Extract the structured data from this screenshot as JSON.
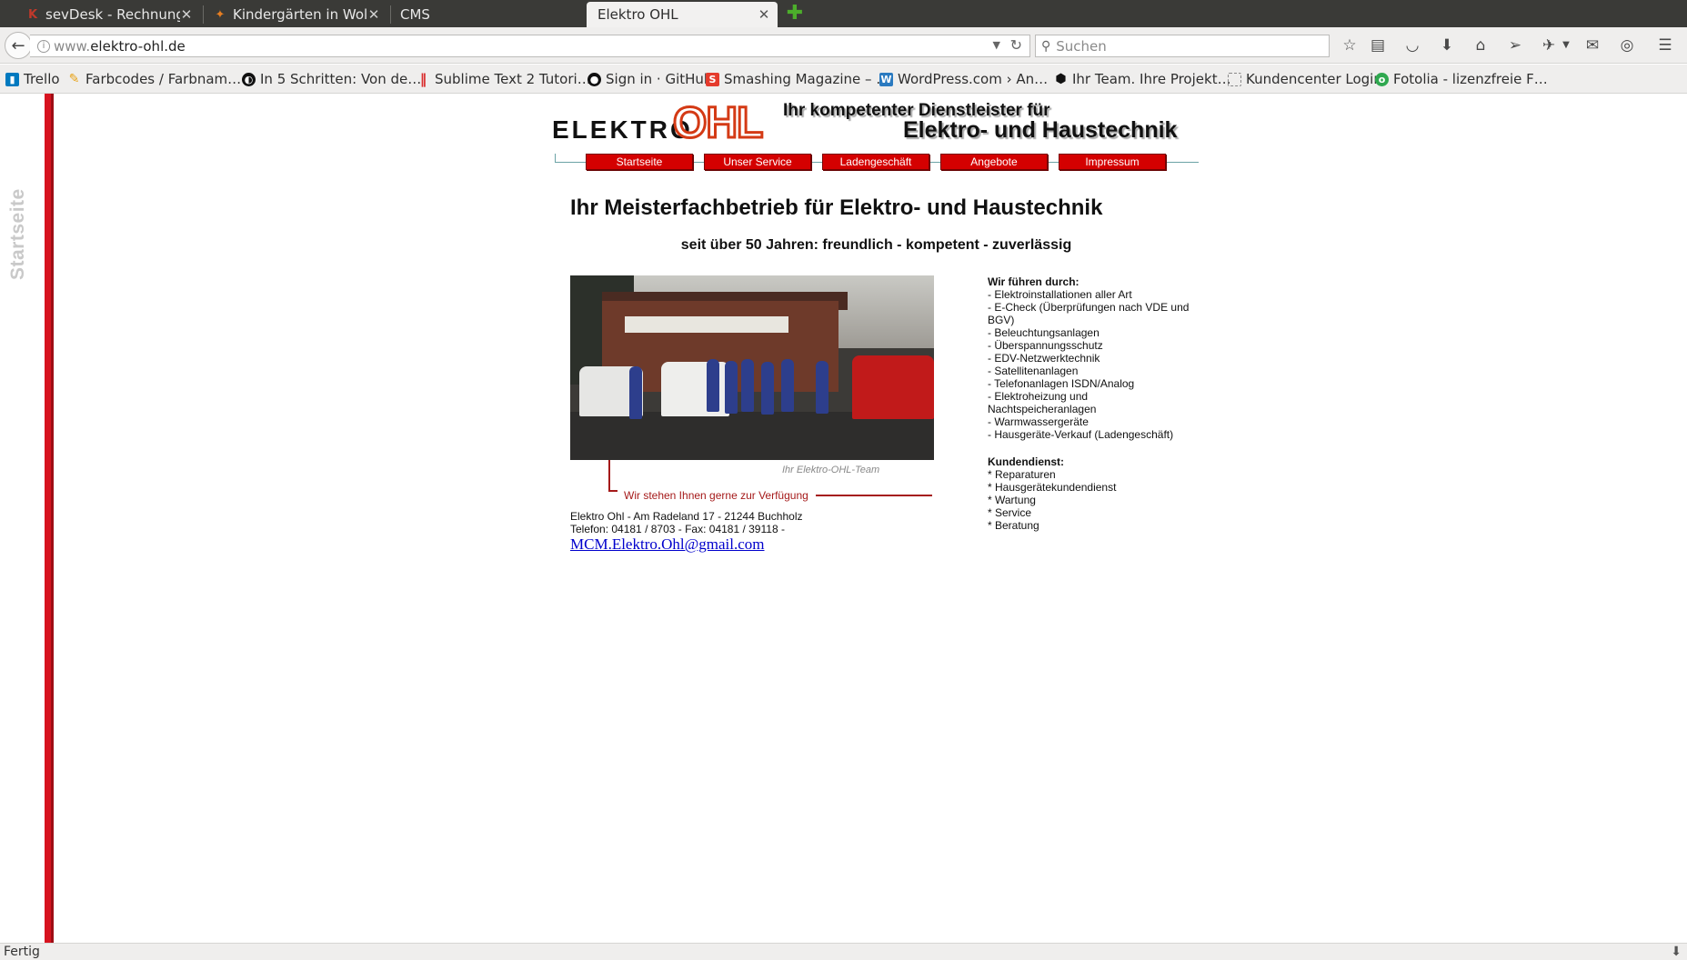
{
  "browser": {
    "tabs": [
      {
        "title": "sevDesk - Rechnung…",
        "icon": "sevdesk-icon",
        "active": false
      },
      {
        "title": "Kindergärten in Wol…",
        "icon": "kindergarten-icon",
        "active": false
      },
      {
        "title": "CMS",
        "icon": "",
        "active": false
      },
      {
        "title": "Elektro OHL",
        "icon": "",
        "active": true
      }
    ],
    "url_prefix": "www.",
    "url_host": "elektro-ohl.de",
    "search_placeholder": "Suchen",
    "status": "Fertig"
  },
  "bookmarks": [
    {
      "label": "Trello",
      "icon": "trello-icon",
      "color": "#0079bf"
    },
    {
      "label": "Farbcodes / Farbnam…",
      "icon": "palette-icon",
      "color": "#e8a317"
    },
    {
      "label": "In 5 Schritten: Von de…",
      "icon": "circle-icon",
      "color": "#111111"
    },
    {
      "label": "Sublime Text 2 Tutori…",
      "icon": "bars-icon",
      "color": "#d92b2b"
    },
    {
      "label": "Sign in · GitHub",
      "icon": "github-icon",
      "color": "#111111"
    },
    {
      "label": "Smashing Magazine – …",
      "icon": "smashing-icon",
      "color": "#e53b2c"
    },
    {
      "label": "WordPress.com › An…",
      "icon": "wordpress-icon",
      "color": "#2a7ac0"
    },
    {
      "label": "Ihr Team. Ihre Projekt…",
      "icon": "hexagon-icon",
      "color": "#111111"
    },
    {
      "label": "Kundencenter Login",
      "icon": "page-icon",
      "color": "#888888"
    },
    {
      "label": "Fotolia - lizenzfreie F…",
      "icon": "fotolia-icon",
      "color": "#2fa84f"
    }
  ],
  "site": {
    "side_label": "Startseite",
    "logo_word": "ELEKTRO",
    "logo_brand": "OHL",
    "tagline_1": "Ihr kompetenter Dienstleister für",
    "tagline_2": "Elektro- und Haustechnik",
    "menu": [
      "Startseite",
      "Unser Service",
      "Ladengeschäft",
      "Angebote",
      "Impressum"
    ],
    "heading": "Ihr Meisterfachbetrieb für Elektro- und Haustechnik",
    "subheading": "seit über 50 Jahren: freundlich - kompetent - zuverlässig",
    "photo_caption": "Ihr Elektro-OHL-Team",
    "bracket_text": "Wir stehen Ihnen gerne zur Verfügung",
    "address_line": "Elektro Ohl - Am Radeland 17 - 21244 Buchholz",
    "phone_line": "Telefon: 04181 / 8703 - Fax: 04181 / 39118 -",
    "email": "MCM.Elektro.Ohl@gmail.com",
    "services_title": "Wir führen durch:",
    "services": [
      "- Elektroinstallationen aller Art",
      "- E-Check (Überprüfungen nach VDE und BGV)",
      "- Beleuchtungsanlagen",
      "- Überspannungsschutz",
      "- EDV-Netzwerktechnik",
      "- Satellitenanlagen",
      "- Telefonanlagen ISDN/Analog",
      "- Elektroheizung und Nachtspeicheranlagen",
      "- Warmwassergeräte",
      "- Hausgeräte-Verkauf (Ladengeschäft)"
    ],
    "customer_title": "Kundendienst:",
    "customer_service": [
      "* Reparaturen",
      "* Hausgerätekundendienst",
      "* Wartung",
      "* Service",
      "* Beratung"
    ],
    "colors": {
      "accent_red": "#d40000",
      "brand_orange": "#d43a15",
      "side_bar_red": "#d7131f"
    }
  }
}
